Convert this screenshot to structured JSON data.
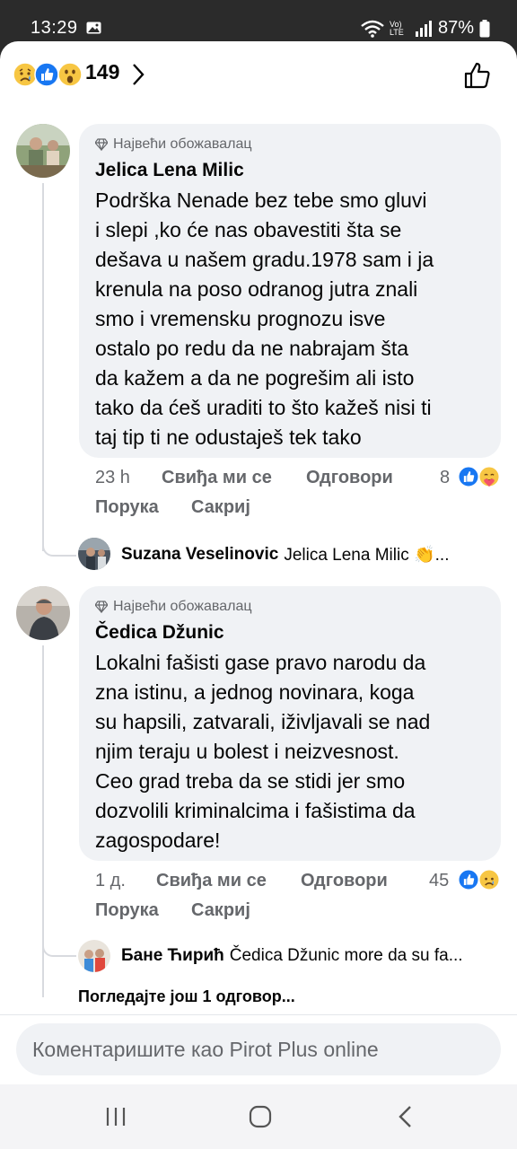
{
  "status_bar": {
    "time": "13:29",
    "network_label": "Vo) LTE",
    "battery": "87%"
  },
  "header": {
    "reactions": [
      "sad-reaction",
      "like-reaction",
      "wow-reaction"
    ],
    "reaction_count": "149"
  },
  "comments": [
    {
      "badge": "Највећи обожавалац",
      "author": "Jelica Lena Milic",
      "lines": [
        "Podrška Nenade bez tebe smo gluvi",
        "i slepi ,ko će nas obavestiti šta se",
        "dešava u našem gradu.1978 sam i ja",
        "krenula na poso odranog jutra znali",
        "smo i vremensku prognozu isve",
        "ostalo po redu da ne nabrajam šta",
        "da kažem a da ne pogrešim ali isto",
        "tako da ćeš uraditi to što kažeš nisi ti",
        "taj tip ti ne odustaješ tek tako"
      ],
      "time": "23 h",
      "like_label": "Свиђа ми се",
      "reply_label": "Одговори",
      "message_label": "Порука",
      "hide_label": "Сакриј",
      "reaction_count": "8",
      "reactions": [
        "like-reaction",
        "care-reaction"
      ],
      "reply": {
        "author": "Suzana Veselinovic",
        "text": "Jelica Lena Milic 👏..."
      }
    },
    {
      "badge": "Највећи обожавалац",
      "author": "Čedica Džunic",
      "lines": [
        "Lokalni fašisti gase pravo narodu da",
        "zna istinu, a jednog novinara, koga",
        "su hapsili, zatvarali, iživljavali se nad",
        "njim teraju u bolest i neizvesnost.",
        "Ceo grad treba da se stidi jer smo",
        "dozvolili kriminalcima i fašistima da",
        "zagospodare!"
      ],
      "time": "1 д.",
      "like_label": "Свиђа ми се",
      "reply_label": "Одговори",
      "message_label": "Порука",
      "hide_label": "Сакриј",
      "reaction_count": "45",
      "reactions": [
        "like-reaction",
        "sad-reaction"
      ],
      "reply": {
        "author": "Бане Ћирић",
        "text": "Čedica Džunic more da su fa..."
      },
      "more_replies": "Погледајте још 1 одговор..."
    }
  ],
  "composer": {
    "placeholder": "Коментаришите као Pirot Plus online"
  },
  "colors": {
    "like_blue": "#1877f2",
    "bubble_gray": "#f0f2f5",
    "secondary_text": "#65676b"
  }
}
